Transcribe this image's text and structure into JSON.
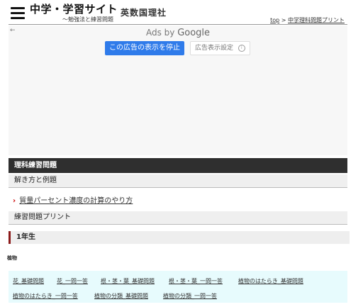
{
  "header": {
    "site_title": "中学・学習サイト",
    "subtitle": "～勉強法と練習問題",
    "subjects": "英数国理社",
    "breadcrumb": {
      "home": "top",
      "separator": ">",
      "current": "中学理科問題プリント"
    }
  },
  "ad": {
    "back_arrow": "←",
    "ads_by": "Ads by",
    "brand": "Google",
    "stop_button": "この広告の表示を停止",
    "settings_button": "広告表示設定",
    "info_icon": "i"
  },
  "sections": {
    "main_heading": "理科練習問題",
    "how_to": "解き方と例題",
    "how_to_link": "質量パーセント濃度の計算のやり方",
    "prints": "練習問題プリント",
    "grade": "1年生",
    "category": "植物"
  },
  "links": [
    "花_基礎問題",
    "花_一問一答",
    "根・茎・葉_基礎問題",
    "根・茎・葉_一問一答",
    "植物のはたらき_基礎問題",
    "植物のはたらき_一問一答",
    "植物の分類_基礎問題",
    "植物の分類_一問一答"
  ],
  "colors": {
    "dark_bar": "#2f2f2f",
    "accent": "#8b1a1a",
    "ad_button": "#2f7bea",
    "links_bg": "#e7fbfd"
  }
}
